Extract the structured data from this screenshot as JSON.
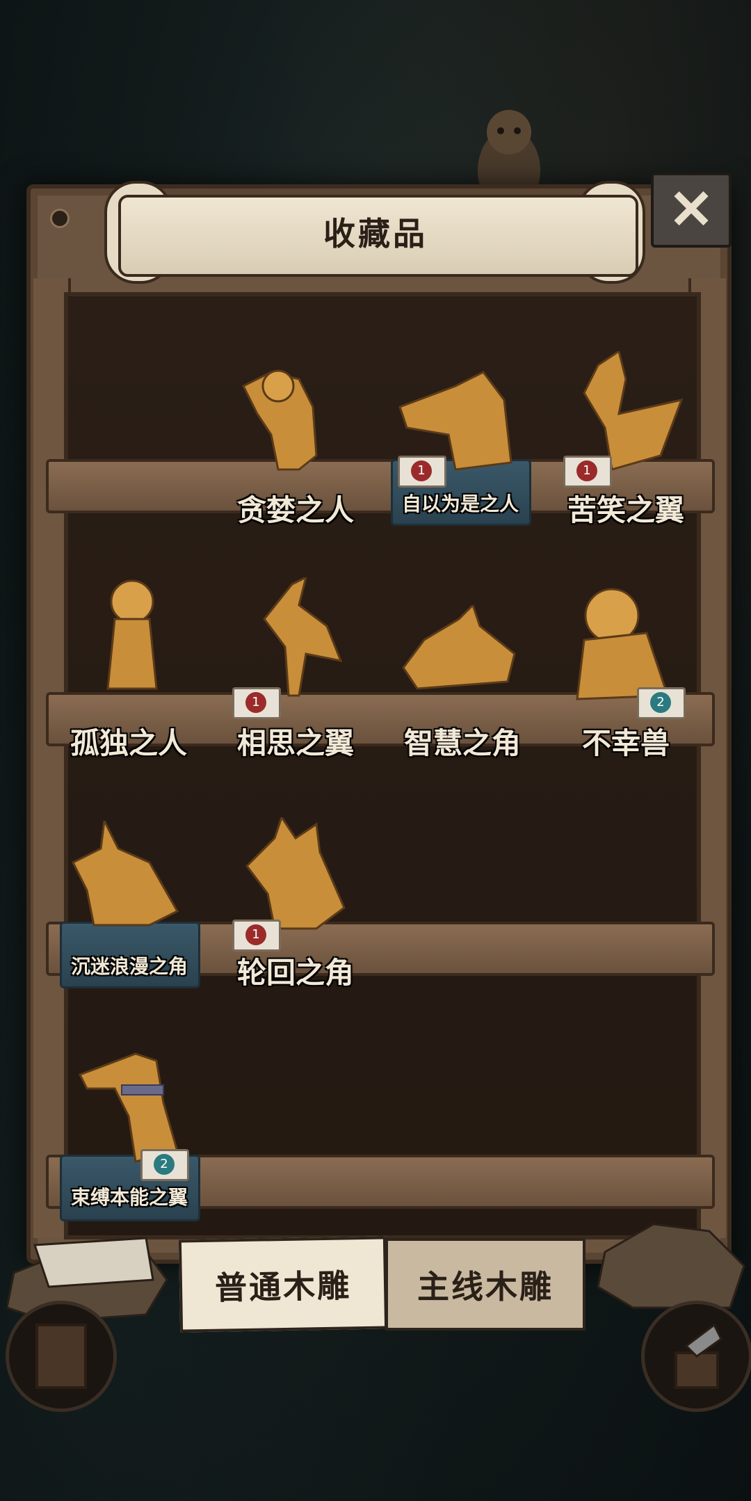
{
  "header": {
    "title": "收藏品"
  },
  "close_icon": "close-x-icon",
  "shelves": [
    {
      "items": [
        {
          "label": "贪婪之人",
          "badge": null,
          "highlighted": false
        },
        {
          "label": "自以为是之人",
          "badge": "1",
          "highlighted": true
        },
        {
          "label": "苦笑之翼",
          "badge": "1",
          "highlighted": false
        }
      ]
    },
    {
      "items": [
        {
          "label": "孤独之人",
          "badge": null,
          "highlighted": false
        },
        {
          "label": "相思之翼",
          "badge": "1",
          "highlighted": false
        },
        {
          "label": "智慧之角",
          "badge": null,
          "highlighted": false
        },
        {
          "label": "不幸兽",
          "badge": "2",
          "highlighted": false
        }
      ]
    },
    {
      "items": [
        {
          "label": "沉迷浪漫之角",
          "badge": null,
          "highlighted": true
        },
        {
          "label": "轮回之角",
          "badge": "1",
          "highlighted": false
        }
      ]
    },
    {
      "items": [
        {
          "label": "束缚本能之翼",
          "badge": "2",
          "highlighted": true
        }
      ]
    }
  ],
  "tabs": {
    "normal": "普通木雕",
    "main": "主线木雕"
  },
  "colors": {
    "wood": "#6b5440",
    "carving": "#c98e3a",
    "highlight": "#3a5868",
    "badge_red": "#9b2b2b",
    "badge_teal": "#2b7a7f"
  }
}
